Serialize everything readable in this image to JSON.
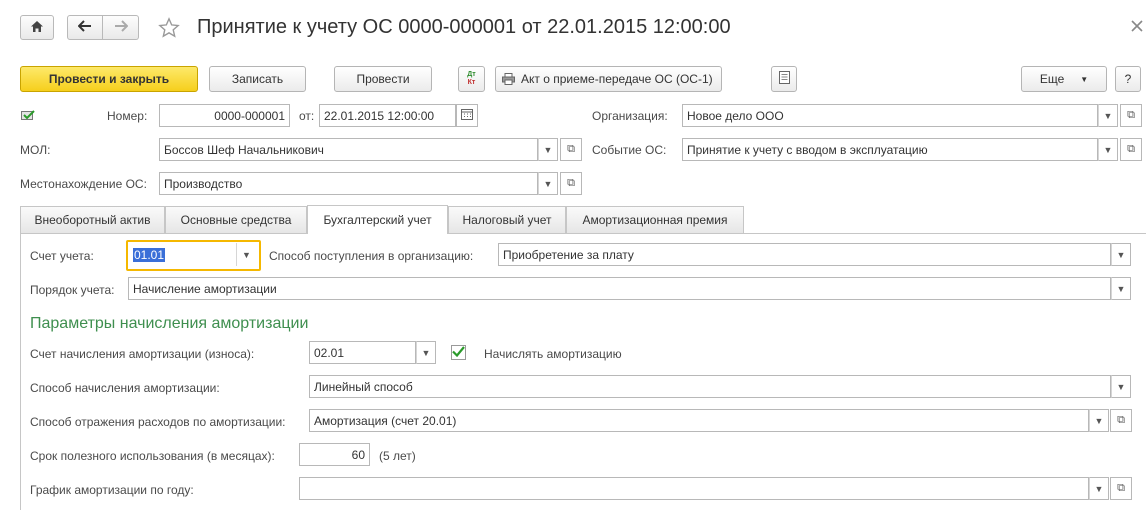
{
  "header": {
    "home_icon": "home-icon",
    "back_icon": "arrow-left-icon",
    "forward_icon": "arrow-right-icon",
    "favorite_icon": "star-icon",
    "title": "Принятие к учету ОС 0000-000001 от 22.01.2015 12:00:00",
    "close_icon": "close-icon"
  },
  "toolbar": {
    "post_close": "Провести и закрыть",
    "save": "Записать",
    "post": "Провести",
    "dtkt_icon": "dt-kt-icon",
    "dt": "Дт",
    "kt": "Кт",
    "print_icon": "printer-icon",
    "print_act": "Акт о приеме-передаче ОС (ОС-1)",
    "doc_icon": "document-icon",
    "more": "Еще",
    "help": "?"
  },
  "form": {
    "posted_icon": "posted-doc-icon",
    "number_label": "Номер:",
    "number_value": "0000-000001",
    "date_label": "от:",
    "date_value": "22.01.2015 12:00:00",
    "org_label": "Организация:",
    "org_value": "Новое дело ООО",
    "mol_label": "МОЛ:",
    "mol_value": "Боссов Шеф Начальникович",
    "event_label": "Событие ОС:",
    "event_value": "Принятие к учету с вводом в эксплуатацию",
    "location_label": "Местонахождение ОС:",
    "location_value": "Производство"
  },
  "tabs": [
    {
      "label": "Внеоборотный актив"
    },
    {
      "label": "Основные средства"
    },
    {
      "label": "Бухгалтерский учет"
    },
    {
      "label": "Налоговый учет"
    },
    {
      "label": "Амортизационная премия"
    }
  ],
  "accounting": {
    "account_label": "Счет учета:",
    "account_value": "01.01",
    "receipt_label": "Способ поступления в организацию:",
    "receipt_value": "Приобретение за плату",
    "order_label": "Порядок учета:",
    "order_value": "Начисление амортизации",
    "section_title": "Параметры начисления амортизации",
    "depr_account_label": "Счет начисления амортизации (износа):",
    "depr_account_value": "02.01",
    "charge_depr_label": "Начислять амортизацию",
    "charge_depr_checked": true,
    "method_label": "Способ начисления амортизации:",
    "method_value": "Линейный способ",
    "expense_label": "Способ отражения расходов по амортизации:",
    "expense_value": "Амортизация (счет 20.01)",
    "life_label": "Срок полезного использования (в месяцах):",
    "life_value": "60",
    "life_years": "(5 лет)",
    "schedule_label": "График амортизации по году:",
    "schedule_value": ""
  },
  "colors": {
    "primary_button": "#f6cf1c",
    "section_title": "#3f8f4f",
    "focus_border": "#f5b800",
    "selection": "#3a6fd8"
  }
}
